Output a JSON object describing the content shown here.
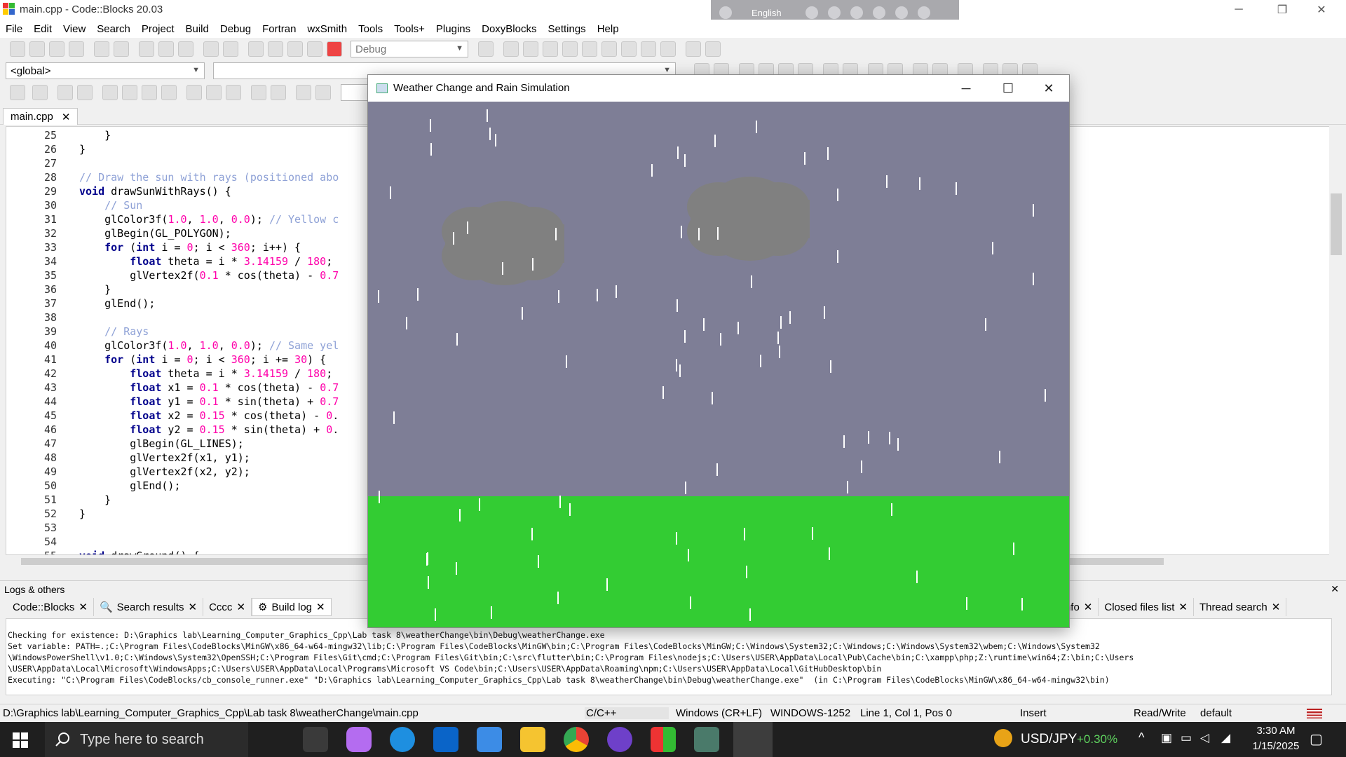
{
  "window": {
    "title": "main.cpp - Code::Blocks 20.03",
    "min_glyph": "─",
    "max_glyph": "❐",
    "close_glyph": "✕"
  },
  "langbar": {
    "language": "English"
  },
  "menu": [
    "File",
    "Edit",
    "View",
    "Search",
    "Project",
    "Build",
    "Debug",
    "Fortran",
    "wxSmith",
    "Tools",
    "Tools+",
    "Plugins",
    "DoxyBlocks",
    "Settings",
    "Help"
  ],
  "toolbar": {
    "build_target": "Debug",
    "scope": "<global>"
  },
  "editor": {
    "tab_label": "main.cpp",
    "close_glyph": "✕",
    "lines": [
      {
        "n": "25",
        "t": "    }"
      },
      {
        "n": "26",
        "t": "}"
      },
      {
        "n": "27",
        "t": ""
      },
      {
        "n": "28",
        "t": "// Draw the sun with rays (positioned abo"
      },
      {
        "n": "29",
        "t": "void drawSunWithRays() {"
      },
      {
        "n": "30",
        "t": "    // Sun"
      },
      {
        "n": "31",
        "t": "    glColor3f(1.0, 1.0, 0.0); // Yellow c"
      },
      {
        "n": "32",
        "t": "    glBegin(GL_POLYGON);"
      },
      {
        "n": "33",
        "t": "    for (int i = 0; i < 360; i++) {"
      },
      {
        "n": "34",
        "t": "        float theta = i * 3.14159 / 180;"
      },
      {
        "n": "35",
        "t": "        glVertex2f(0.1 * cos(theta) - 0.7"
      },
      {
        "n": "36",
        "t": "    }"
      },
      {
        "n": "37",
        "t": "    glEnd();"
      },
      {
        "n": "38",
        "t": ""
      },
      {
        "n": "39",
        "t": "    // Rays"
      },
      {
        "n": "40",
        "t": "    glColor3f(1.0, 1.0, 0.0); // Same yel"
      },
      {
        "n": "41",
        "t": "    for (int i = 0; i < 360; i += 30) {"
      },
      {
        "n": "42",
        "t": "        float theta = i * 3.14159 / 180;"
      },
      {
        "n": "43",
        "t": "        float x1 = 0.1 * cos(theta) - 0.7"
      },
      {
        "n": "44",
        "t": "        float y1 = 0.1 * sin(theta) + 0.7"
      },
      {
        "n": "45",
        "t": "        float x2 = 0.15 * cos(theta) - 0."
      },
      {
        "n": "46",
        "t": "        float y2 = 0.15 * sin(theta) + 0."
      },
      {
        "n": "47",
        "t": "        glBegin(GL_LINES);"
      },
      {
        "n": "48",
        "t": "        glVertex2f(x1, y1);"
      },
      {
        "n": "49",
        "t": "        glVertex2f(x2, y2);"
      },
      {
        "n": "50",
        "t": "        glEnd();"
      },
      {
        "n": "51",
        "t": "    }"
      },
      {
        "n": "52",
        "t": "}"
      },
      {
        "n": "53",
        "t": ""
      },
      {
        "n": "54",
        "t": ""
      },
      {
        "n": "55",
        "t": "void drawGround() {"
      }
    ]
  },
  "logs": {
    "header": "Logs & others",
    "tabs": [
      "Code::Blocks",
      "Search results",
      "Cccc",
      "Build log",
      "tran info",
      "Closed files list",
      "Thread search"
    ],
    "lines": [
      "Checking for existence: D:\\Graphics lab\\Learning_Computer_Graphics_Cpp\\Lab task 8\\weatherChange\\bin\\Debug\\weatherChange.exe",
      "Set variable: PATH=.;C:\\Program Files\\CodeBlocks\\MinGW\\x86_64-w64-mingw32\\lib;C:\\Program Files\\CodeBlocks\\MinGW\\bin;C:\\Program Files\\CodeBlocks\\MinGW;C:\\Windows\\System32;C:\\Windows;C:\\Windows\\System32\\wbem;C:\\Windows\\System32",
      "\\WindowsPowerShell\\v1.0;C:\\Windows\\System32\\OpenSSH;C:\\Program Files\\Git\\cmd;C:\\Program Files\\Git\\bin;C:\\src\\flutter\\bin;C:\\Program Files\\nodejs;C:\\Users\\USER\\AppData\\Local\\Pub\\Cache\\bin;C:\\xampp\\php;Z:\\runtime\\win64;Z:\\bin;C:\\Users",
      "\\USER\\AppData\\Local\\Microsoft\\WindowsApps;C:\\Users\\USER\\AppData\\Local\\Programs\\Microsoft VS Code\\bin;C:\\Users\\USER\\AppData\\Roaming\\npm;C:\\Users\\USER\\AppData\\Local\\GitHubDesktop\\bin",
      "Executing: \"C:\\Program Files\\CodeBlocks/cb_console_runner.exe\" \"D:\\Graphics lab\\Learning_Computer_Graphics_Cpp\\Lab task 8\\weatherChange\\bin\\Debug\\weatherChange.exe\"  (in C:\\Program Files\\CodeBlocks\\MinGW\\x86_64-w64-mingw32\\bin)"
    ]
  },
  "status": {
    "path": "D:\\Graphics lab\\Learning_Computer_Graphics_Cpp\\Lab task 8\\weatherChange\\main.cpp",
    "lang": "C/C++",
    "eol": "Windows (CR+LF)",
    "encoding": "WINDOWS-1252",
    "position": "Line 1, Col 1, Pos 0",
    "mode": "Insert",
    "access": "Read/Write",
    "profile": "default"
  },
  "taskbar": {
    "search_placeholder": "Type here to search",
    "ticker": "USD/JPY",
    "ticker_change": "+0.30%",
    "time": "3:30 AM",
    "date": "1/15/2025"
  },
  "sim_window": {
    "title": "Weather Change and Rain Simulation",
    "colors": {
      "sky": "#7e7e96",
      "cloud": "#808080",
      "ground": "#33cc33",
      "rain": "#ffffff"
    },
    "ground_fraction": 0.25
  }
}
